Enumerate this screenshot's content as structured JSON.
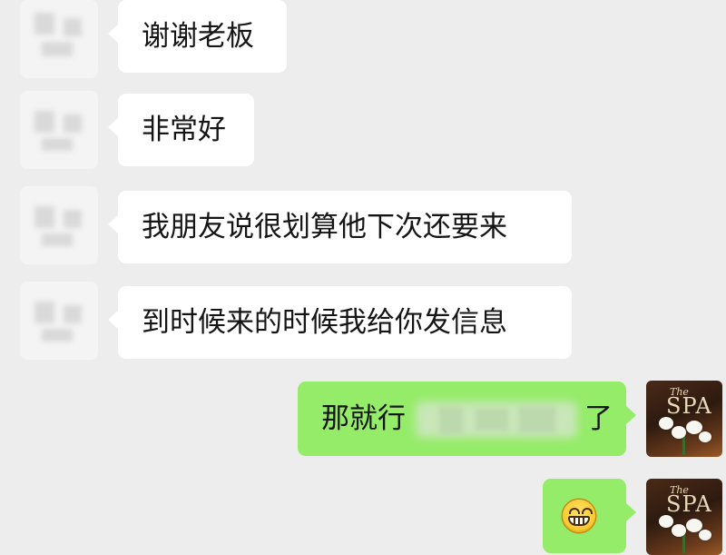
{
  "messages": [
    {
      "side": "in",
      "text": "谢谢老板"
    },
    {
      "side": "in",
      "text": "非常好"
    },
    {
      "side": "in",
      "text": "我朋友说很划算他下次还要来"
    },
    {
      "side": "in",
      "text": "到时候来的时候我给你发信息"
    },
    {
      "side": "out",
      "text_visible_start": "那就行",
      "text_visible_end": "了",
      "has_redaction": true
    },
    {
      "side": "out",
      "emoji": "grinning-face"
    }
  ],
  "avatar_right": {
    "logo_line1": "The",
    "logo_line2": "SPA"
  },
  "colors": {
    "background": "#ededed",
    "incoming_bubble": "#ffffff",
    "outgoing_bubble": "#95ec69"
  }
}
